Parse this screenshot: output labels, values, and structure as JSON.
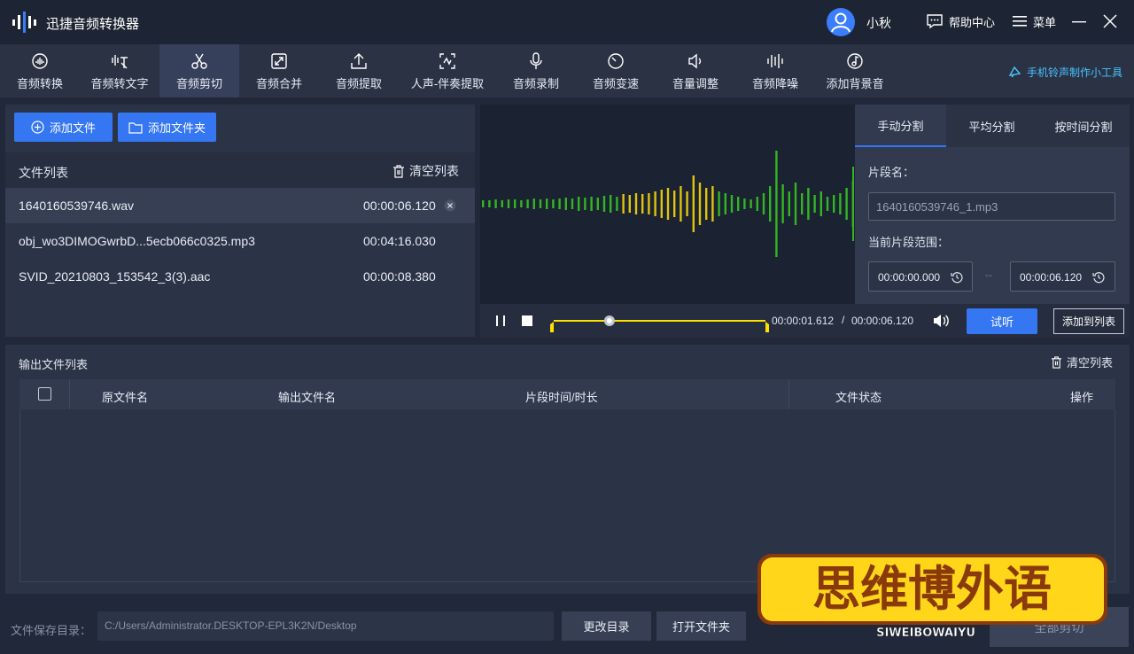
{
  "app": {
    "title": "迅捷音频转换器",
    "username": "小秋",
    "help": "帮助中心",
    "menu": "菜单"
  },
  "toolbar": [
    {
      "label": "音频转换",
      "icon": "audio-convert-icon"
    },
    {
      "label": "音频转文字",
      "icon": "audio-to-text-icon"
    },
    {
      "label": "音频剪切",
      "icon": "scissors-icon"
    },
    {
      "label": "音频合并",
      "icon": "merge-icon"
    },
    {
      "label": "音频提取",
      "icon": "extract-icon"
    },
    {
      "label": "人声-伴奏提取",
      "icon": "vocal-icon"
    },
    {
      "label": "音频录制",
      "icon": "microphone-icon"
    },
    {
      "label": "音频变速",
      "icon": "speed-icon"
    },
    {
      "label": "音量调整",
      "icon": "volume-icon"
    },
    {
      "label": "音频降噪",
      "icon": "denoise-icon"
    },
    {
      "label": "添加背景音",
      "icon": "music-disc-icon"
    }
  ],
  "ring_tool": "手机铃声制作小工具",
  "files": {
    "add_file": "添加文件",
    "add_folder": "添加文件夹",
    "list_title": "文件列表",
    "clear": "清空列表",
    "items": [
      {
        "name": "1640160539746.wav",
        "duration": "00:00:06.120"
      },
      {
        "name": "obj_wo3DIMOGwrbD...5ecb066c0325.mp3",
        "duration": "00:04:16.030"
      },
      {
        "name": "SVID_20210803_153542_3(3).aac",
        "duration": "00:00:08.380"
      }
    ]
  },
  "split": {
    "tabs": [
      "手动分割",
      "平均分割",
      "按时间分割"
    ],
    "segment_name_label": "片段名：",
    "segment_name": "1640160539746_1.mp3",
    "range_label": "当前片段范围：",
    "start": "00:00:00.000",
    "end": "00:00:06.120",
    "range_separator": "--"
  },
  "player": {
    "current": "00:00:01.612",
    "separator": "/",
    "total": "00:00:06.120",
    "progress": 0.263,
    "preview": "试听",
    "add_to_list": "添加到列表"
  },
  "output": {
    "title": "输出文件列表",
    "clear": "清空列表",
    "columns": [
      "原文件名",
      "输出文件名",
      "片段时间/时长",
      "文件状态",
      "操作"
    ]
  },
  "footer": {
    "save_label": "文件保存目录：",
    "path": "C:/Users/Administrator.DESKTOP-EPL3K2N/Desktop",
    "change": "更改目录",
    "open": "打开文件夹",
    "split_all": "全部剪切"
  },
  "watermark": {
    "title": "思维博外语",
    "subtitle": "SIWEIBOWAIYU"
  },
  "colors": {
    "accent": "#3577f2",
    "wave_green": "#33b524",
    "wave_yellow": "#e0c30f",
    "range": "#ffe100",
    "link": "#48c4ff"
  }
}
